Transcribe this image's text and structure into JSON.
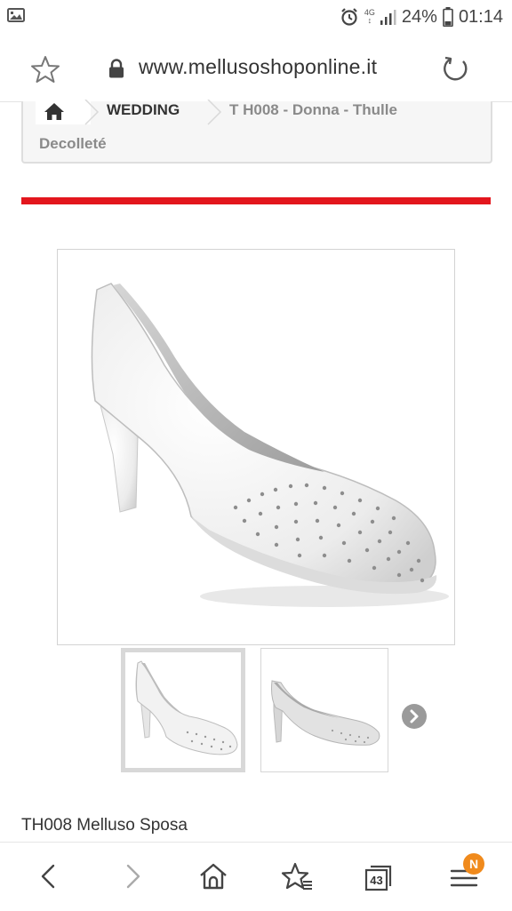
{
  "status_bar": {
    "network_top": "4G",
    "network_bottom": "↕",
    "battery": "24%",
    "time": "01:14"
  },
  "browser": {
    "url": "www.mellusoshoponline.it",
    "tab_count": "43",
    "menu_badge": "N"
  },
  "breadcrumb": {
    "section": "WEDDING",
    "current_line1": "T H008 - Donna - Thulle",
    "current_line2": "Decolleté"
  },
  "colors": {
    "accent_red": "#e3161d",
    "badge_orange": "#f08a1c"
  },
  "product": {
    "title": "TH008 Melluso Sposa",
    "thumbnails": [
      "shoe-front-thumbnail",
      "shoe-side-thumbnail"
    ]
  },
  "icons": [
    "photo-icon",
    "alarm-icon",
    "signal-icon",
    "battery-icon",
    "star-icon",
    "lock-icon",
    "reload-icon",
    "home-icon",
    "chevron-right-icon",
    "back-icon",
    "forward-icon",
    "bookmark-star-icon",
    "tabs-icon",
    "menu-icon"
  ]
}
